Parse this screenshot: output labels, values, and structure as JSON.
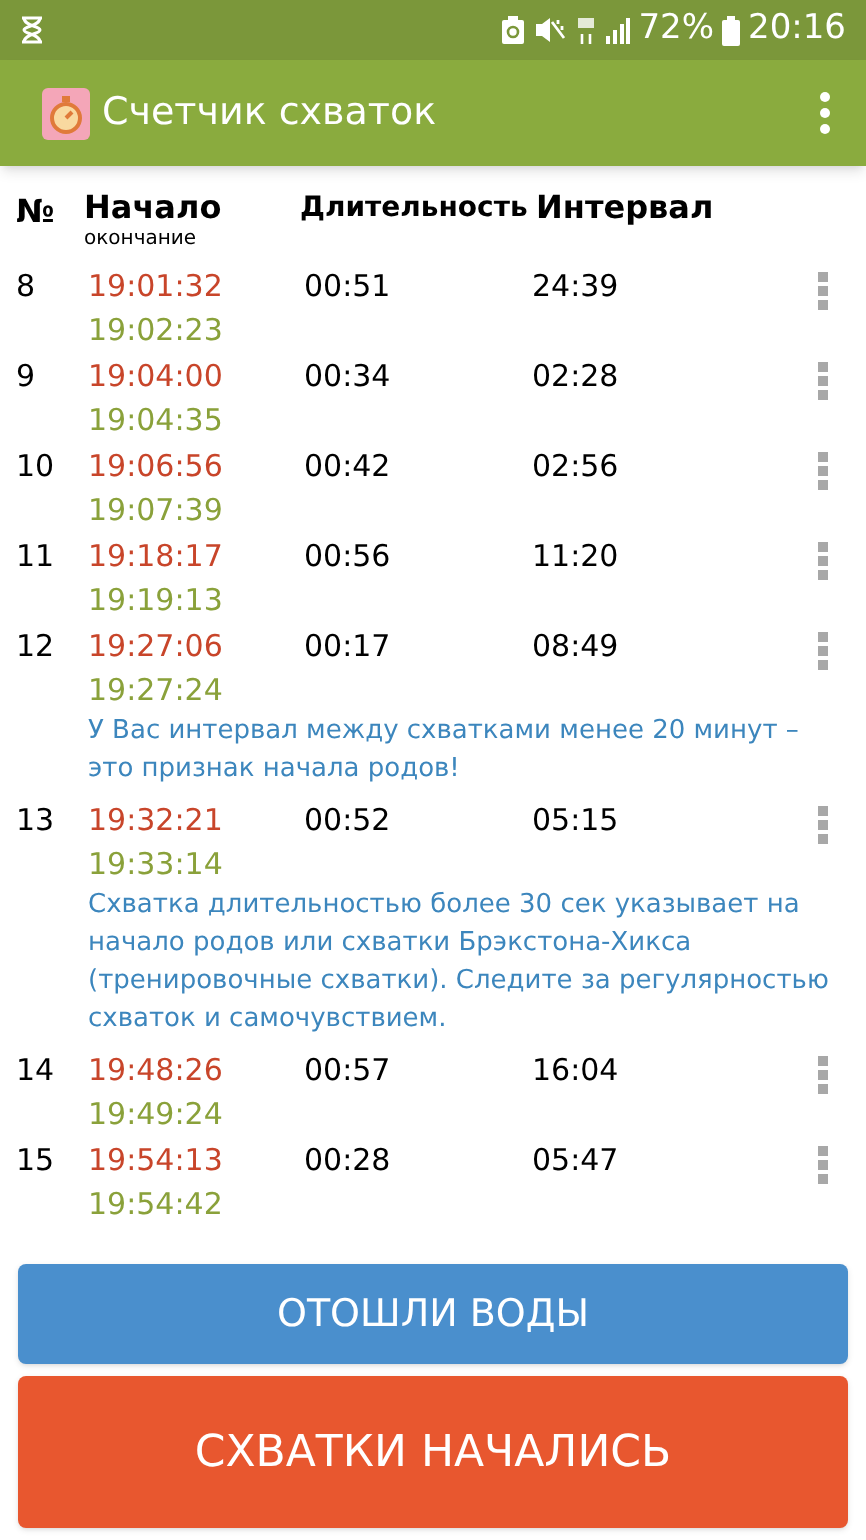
{
  "status_bar": {
    "battery": "72%",
    "time": "20:16"
  },
  "app_bar": {
    "title": "Счетчик схваток"
  },
  "columns": {
    "number": "№",
    "start": "Начало",
    "end": "окончание",
    "duration": "Длительность",
    "interval": "Интервал"
  },
  "rows": [
    {
      "number": "8",
      "start": "19:01:32",
      "end": "19:02:23",
      "duration": "00:51",
      "interval": "24:39"
    },
    {
      "number": "9",
      "start": "19:04:00",
      "end": "19:04:35",
      "duration": "00:34",
      "interval": "02:28"
    },
    {
      "number": "10",
      "start": "19:06:56",
      "end": "19:07:39",
      "duration": "00:42",
      "interval": "02:56"
    },
    {
      "number": "11",
      "start": "19:18:17",
      "end": "19:19:13",
      "duration": "00:56",
      "interval": "11:20"
    },
    {
      "number": "12",
      "start": "19:27:06",
      "end": "19:27:24",
      "duration": "00:17",
      "interval": "08:49",
      "note": "У Вас интервал между схватками менее 20 минут – это признак начала родов!"
    },
    {
      "number": "13",
      "start": "19:32:21",
      "end": "19:33:14",
      "duration": "00:52",
      "interval": "05:15",
      "note": "Схватка длительностью более 30 сек указывает на начало родов или схватки Брэкстона-Хикса (тренировочные схватки). Следите за регулярностью схваток и самочувствием."
    },
    {
      "number": "14",
      "start": "19:48:26",
      "end": "19:49:24",
      "duration": "00:57",
      "interval": "16:04"
    },
    {
      "number": "15",
      "start": "19:54:13",
      "end": "19:54:42",
      "duration": "00:28",
      "interval": "05:47"
    }
  ],
  "buttons": [
    {
      "label": "ОТОШЛИ ВОДЫ",
      "kind": "secondary"
    },
    {
      "label": "СХВАТКИ НАЧАЛИСЬ",
      "kind": "primary"
    }
  ]
}
